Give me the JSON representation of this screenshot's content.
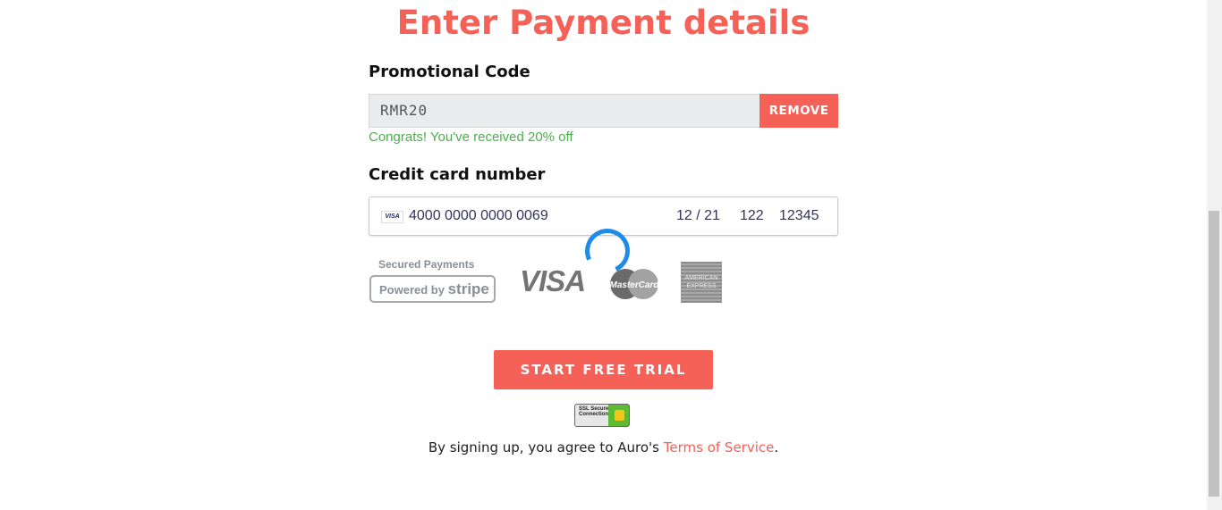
{
  "title": "Enter Payment details",
  "promo": {
    "label": "Promotional Code",
    "value": "RMR20",
    "remove_label": "REMOVE",
    "message": "Congrats! You've received 20% off"
  },
  "card": {
    "label": "Credit card number",
    "brand_icon": "VISA",
    "number": "4000 0000 0000 0069",
    "expiry": "12 / 21",
    "cvc": "122",
    "zip": "12345"
  },
  "badges": {
    "stripe_top": "Secured Payments",
    "stripe_powered": "Powered by",
    "stripe_word": "stripe",
    "visa": "VISA",
    "mastercard": "MasterCard",
    "amex": "AMERICAN EXPRESS",
    "ssl": "SSL Secure Connection"
  },
  "cta_label": "START FREE TRIAL",
  "terms": {
    "prefix": "By signing up, you agree to Auro's ",
    "link": "Terms of Service",
    "suffix": "."
  },
  "colors": {
    "accent": "#f56057",
    "success": "#4cae4c",
    "spinner": "#1e8ce6"
  }
}
